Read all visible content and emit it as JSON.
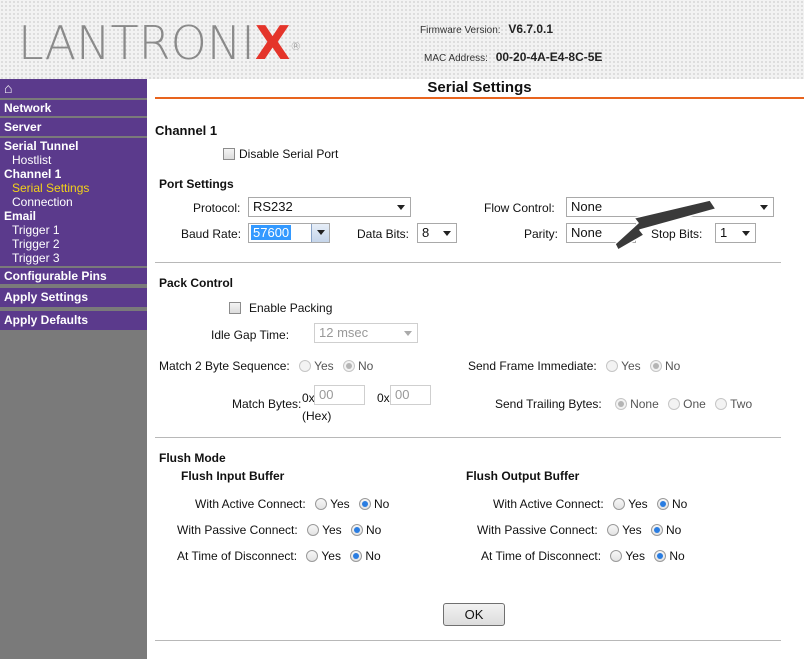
{
  "header": {
    "logo_text": "LANTRONIX",
    "firmware_label": "Firmware Version:",
    "firmware_value": "V6.7.0.1",
    "mac_label": "MAC Address:",
    "mac_value": "00-20-4A-E4-8C-5E",
    "colors": {
      "logo_gray": "#8a8a8a",
      "logo_x": "#e4342a"
    }
  },
  "sidebar": {
    "home_icon": "home-icon",
    "items": [
      {
        "label": "Network"
      },
      {
        "label": "Server"
      },
      {
        "label": "Serial Tunnel"
      },
      {
        "label": "Hostlist"
      },
      {
        "label": "Channel 1"
      },
      {
        "label": "Serial Settings"
      },
      {
        "label": "Connection"
      },
      {
        "label": "Email"
      },
      {
        "label": "Trigger 1"
      },
      {
        "label": "Trigger 2"
      },
      {
        "label": "Trigger 3"
      },
      {
        "label": "Configurable Pins"
      },
      {
        "label": "Apply Settings"
      },
      {
        "label": "Apply Defaults"
      }
    ],
    "colors": {
      "bg": "#5b3a8c",
      "active": "#f3d219",
      "gutter": "#7a7a7a"
    }
  },
  "main": {
    "title": "Serial Settings",
    "channel_heading": "Channel 1",
    "disable_serial_port": {
      "label": "Disable Serial Port",
      "checked": false
    },
    "port_settings": {
      "heading": "Port Settings",
      "protocol_label": "Protocol:",
      "protocol_value": "RS232",
      "flow_control_label": "Flow Control:",
      "flow_control_value": "None",
      "baud_rate_label": "Baud Rate:",
      "baud_rate_value": "57600",
      "data_bits_label": "Data Bits:",
      "data_bits_value": "8",
      "parity_label": "Parity:",
      "parity_value": "None",
      "stop_bits_label": "Stop Bits:",
      "stop_bits_value": "1"
    },
    "pack_control": {
      "heading": "Pack Control",
      "enable_packing_label": "Enable Packing",
      "idle_gap_label": "Idle Gap Time:",
      "idle_gap_value": "12 msec",
      "match_seq_label": "Match 2 Byte Sequence:",
      "send_frame_label": "Send Frame Immediate:",
      "yes": "Yes",
      "no": "No",
      "match_bytes_label": "Match Bytes:",
      "hex_prefix": "0x",
      "match_byte_1": "00",
      "match_byte_2": "00",
      "hex_note": "(Hex)",
      "send_trailing_label": "Send Trailing Bytes:",
      "trailing_none": "None",
      "trailing_one": "One",
      "trailing_two": "Two"
    },
    "flush_mode": {
      "heading": "Flush Mode",
      "input_heading": "Flush Input Buffer",
      "output_heading": "Flush Output Buffer",
      "active_label": "With Active Connect:",
      "passive_label": "With Passive Connect:",
      "disconnect_label": "At Time of Disconnect:",
      "yes": "Yes",
      "no": "No"
    },
    "ok_label": "OK",
    "accent": "#e8641e"
  }
}
